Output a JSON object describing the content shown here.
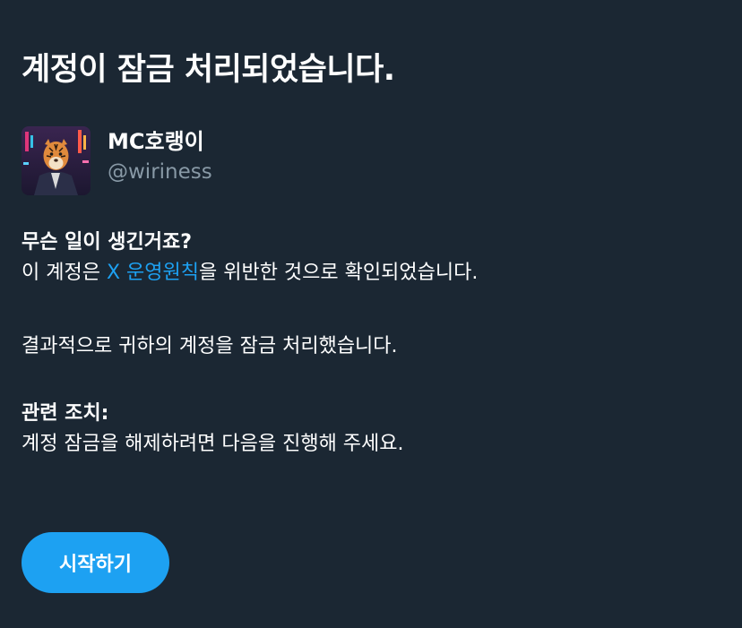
{
  "page": {
    "title": "계정이 잠금 처리되었습니다."
  },
  "profile": {
    "display_name": "MC호랭이",
    "handle": "@wiriness",
    "avatar_icon": "tiger-avatar"
  },
  "what_happened": {
    "title": "무슨 일이 생긴거죠?",
    "text_before_link": "이 계정은 ",
    "link_text": "X 운영원칙",
    "text_after_link": "을 위반한 것으로 확인되었습니다.",
    "result_text": "결과적으로 귀하의 계정을 잠금 처리했습니다."
  },
  "related_actions": {
    "title": "관련 조치:",
    "text": "계정 잠금을 해제하려면 다음을 진행해 주세요."
  },
  "actions": {
    "start_label": "시작하기"
  },
  "colors": {
    "background": "#1b2733",
    "text": "#ffffff",
    "muted": "#8899a6",
    "accent": "#1da1f2"
  }
}
